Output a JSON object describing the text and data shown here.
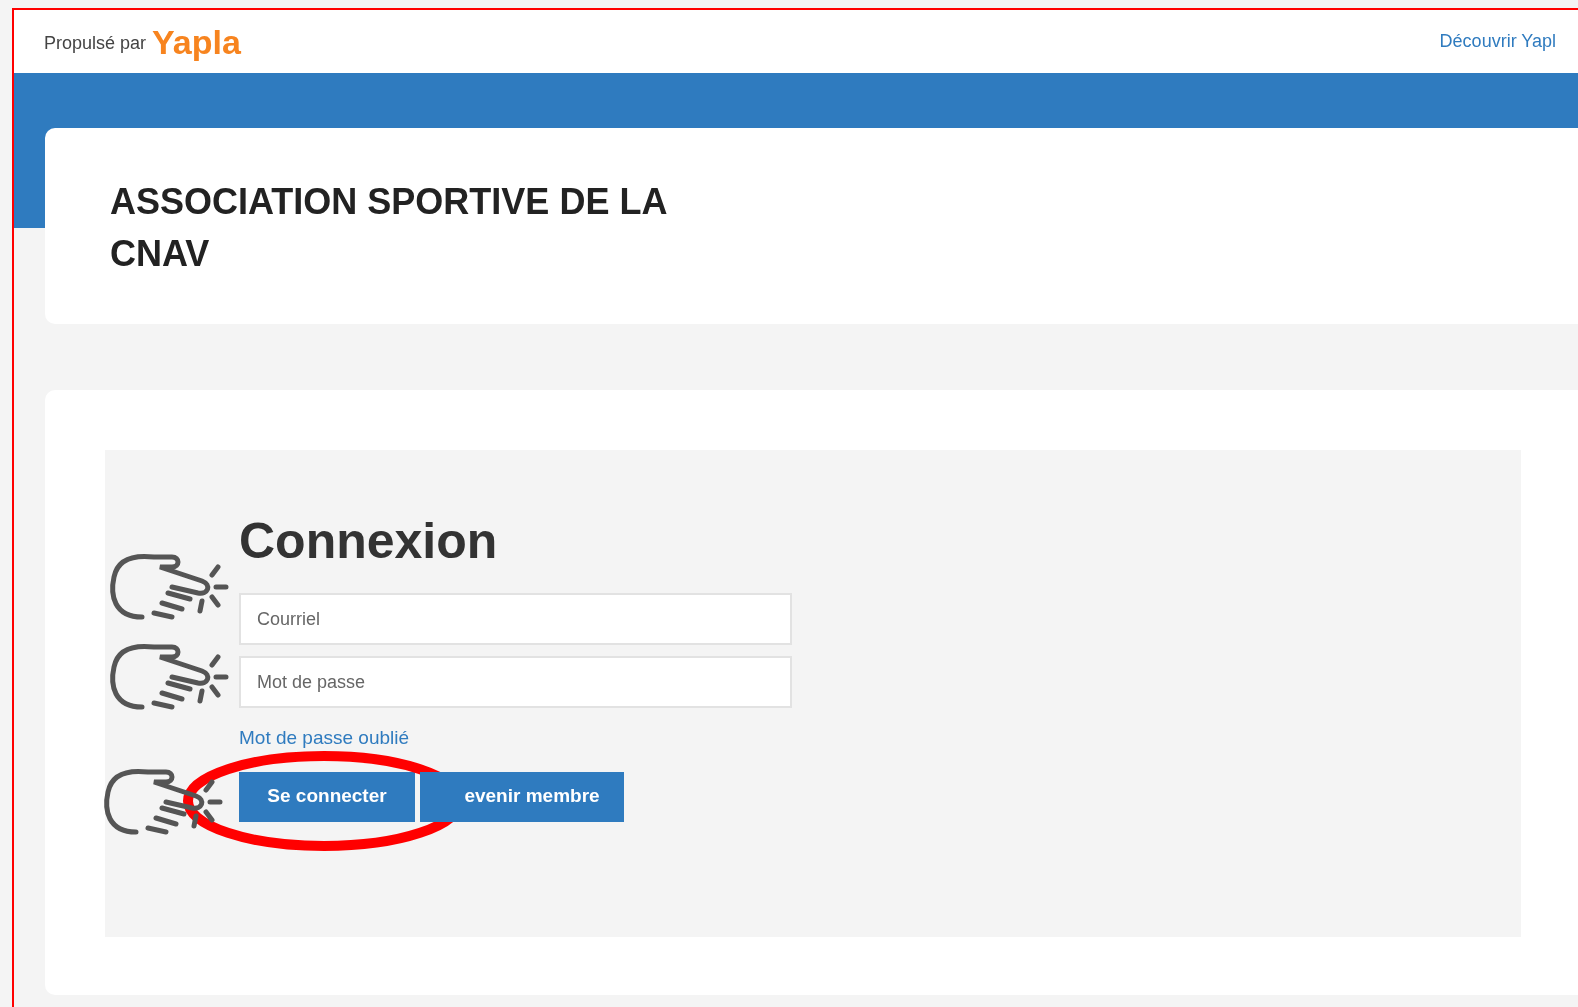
{
  "header": {
    "powered_by": "Propulsé par",
    "brand": "Yapla",
    "discover_link": "Découvrir Yapl"
  },
  "organization": {
    "title": "ASSOCIATION SPORTIVE DE LA CNAV"
  },
  "login": {
    "heading": "Connexion",
    "fields": [
      {
        "placeholder": "Courriel"
      },
      {
        "placeholder": "Mot de passe"
      }
    ],
    "forgot_link": "Mot de passe oublié",
    "buttons": [
      {
        "label": "Se connecter",
        "circled": true
      },
      {
        "label": "evenir membre",
        "circled": false
      }
    ]
  },
  "annotations": {
    "pointers": [
      {
        "kind": "hand"
      },
      {
        "kind": "hand"
      },
      {
        "kind": "hand"
      }
    ]
  }
}
